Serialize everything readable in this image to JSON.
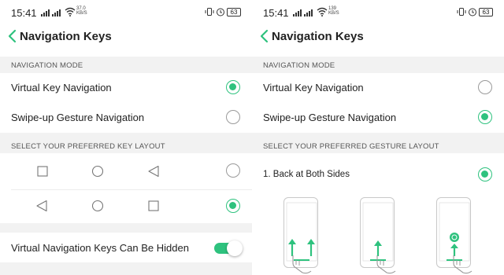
{
  "status_bar": {
    "time": "15:41",
    "left_speed": "37.0\nKB/S",
    "right_speed": "139\nKB/S",
    "battery": "63"
  },
  "header": {
    "title": "Navigation Keys"
  },
  "left": {
    "section_mode": "NAVIGATION MODE",
    "options": [
      {
        "label": "Virtual Key Navigation",
        "selected": true
      },
      {
        "label": "Swipe-up Gesture Navigation",
        "selected": false
      }
    ],
    "section_layout": "SELECT YOUR PREFERRED KEY LAYOUT",
    "layouts": [
      {
        "keys": [
          "square-icon",
          "circle-icon",
          "back-triangle-icon"
        ],
        "selected": false
      },
      {
        "keys": [
          "back-triangle-icon",
          "circle-icon",
          "square-icon"
        ],
        "selected": true
      }
    ],
    "toggle_label": "Virtual Navigation Keys Can Be Hidden",
    "toggle_on": true
  },
  "right": {
    "section_mode": "NAVIGATION MODE",
    "options": [
      {
        "label": "Virtual Key Navigation",
        "selected": false
      },
      {
        "label": "Swipe-up Gesture Navigation",
        "selected": true
      }
    ],
    "section_layout": "SELECT YOUR PREFERRED GESTURE LAYOUT",
    "gesture_option": {
      "label": "1. Back at Both Sides",
      "selected": true
    }
  },
  "colors": {
    "accent": "#2ec27e",
    "section_bg": "#f2f2f2",
    "text": "#222222"
  }
}
